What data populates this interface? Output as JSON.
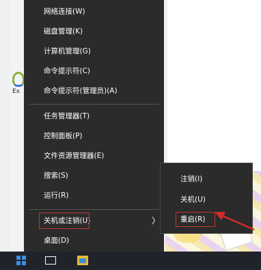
{
  "desktop": {
    "icon_label": "Ex"
  },
  "menu": {
    "items": [
      {
        "label": "网络连接(W)"
      },
      {
        "label": "磁盘管理(K)"
      },
      {
        "label": "计算机管理(G)"
      },
      {
        "label": "命令提示符(C)"
      },
      {
        "label": "命令提示符(管理员)(A)"
      },
      {
        "label": "任务管理器(T)"
      },
      {
        "label": "控制面板(P)"
      },
      {
        "label": "文件资源管理器(E)"
      },
      {
        "label": "搜索(S)"
      },
      {
        "label": "运行(R)"
      },
      {
        "label": "关机或注销(U)"
      },
      {
        "label": "桌面(D)"
      }
    ],
    "submenu_arrow": "〉"
  },
  "submenu": {
    "items": [
      {
        "label": "注销(I)"
      },
      {
        "label": "关机(U)"
      },
      {
        "label": "重启(R)"
      }
    ]
  },
  "colors": {
    "menu_bg": "#2b2b2b",
    "highlight_border": "#c0392b",
    "taskbar_bg": "#20232a",
    "start_blue": "#3d8fe0"
  },
  "icons": {
    "start": "windows-logo-icon",
    "task_view": "task-view-icon",
    "explorer": "file-explorer-icon",
    "pointer": "red-arrow-icon"
  }
}
